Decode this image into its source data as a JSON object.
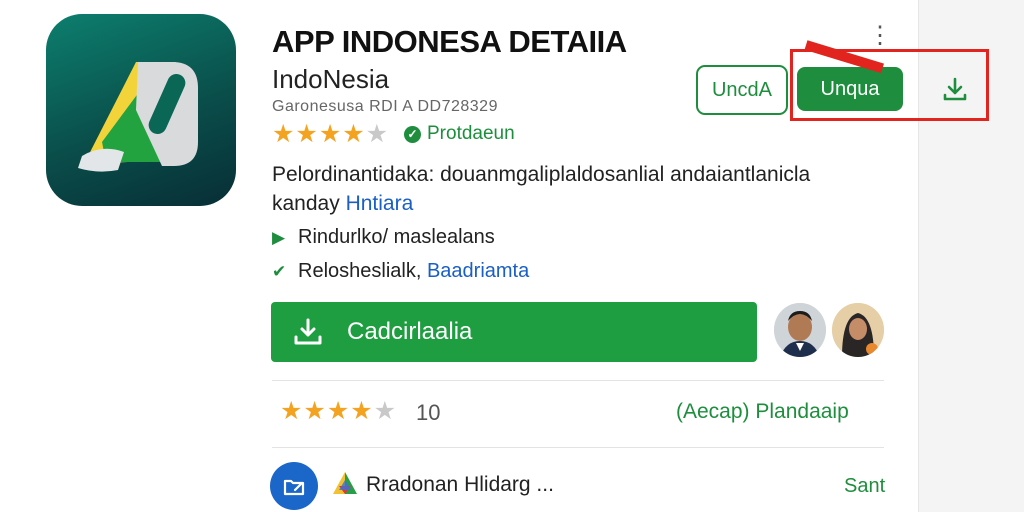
{
  "app": {
    "title": "APP INDONESA DETAIIA",
    "subtitle": "IndoNesia",
    "meta": "Garonesusa RDI A DD728329",
    "rating_stars": 4,
    "badge": "Protdaeun"
  },
  "description": {
    "line1": "Pelordinantidaka: douanmgaliplaldosanlial andaiantlanicla",
    "line2_text": "kanday ",
    "line2_link": "Hntiara"
  },
  "features": [
    {
      "icon": "play-icon",
      "text": "Rindurlko/ maslealans",
      "link": ""
    },
    {
      "icon": "check-icon",
      "text": "Relosheslialk, ",
      "link": "Baadriamta"
    }
  ],
  "actions": {
    "outline_label": "UncdA",
    "primary_label": "Unqua",
    "download_icon": "download-icon",
    "big_button_label": "Cadcirlaalia"
  },
  "ratings": {
    "stars": 4,
    "count": "10",
    "link_label": "(Aecap) Plandaaip"
  },
  "footer": {
    "text": "Rradonan Hlidarg ...",
    "action": "Sant"
  },
  "colors": {
    "accent_green": "#1e8e3e",
    "button_green": "#1e9e40",
    "link_blue": "#1a5fc4",
    "star_gold": "#f4a321",
    "highlight_red": "#e2241f"
  }
}
